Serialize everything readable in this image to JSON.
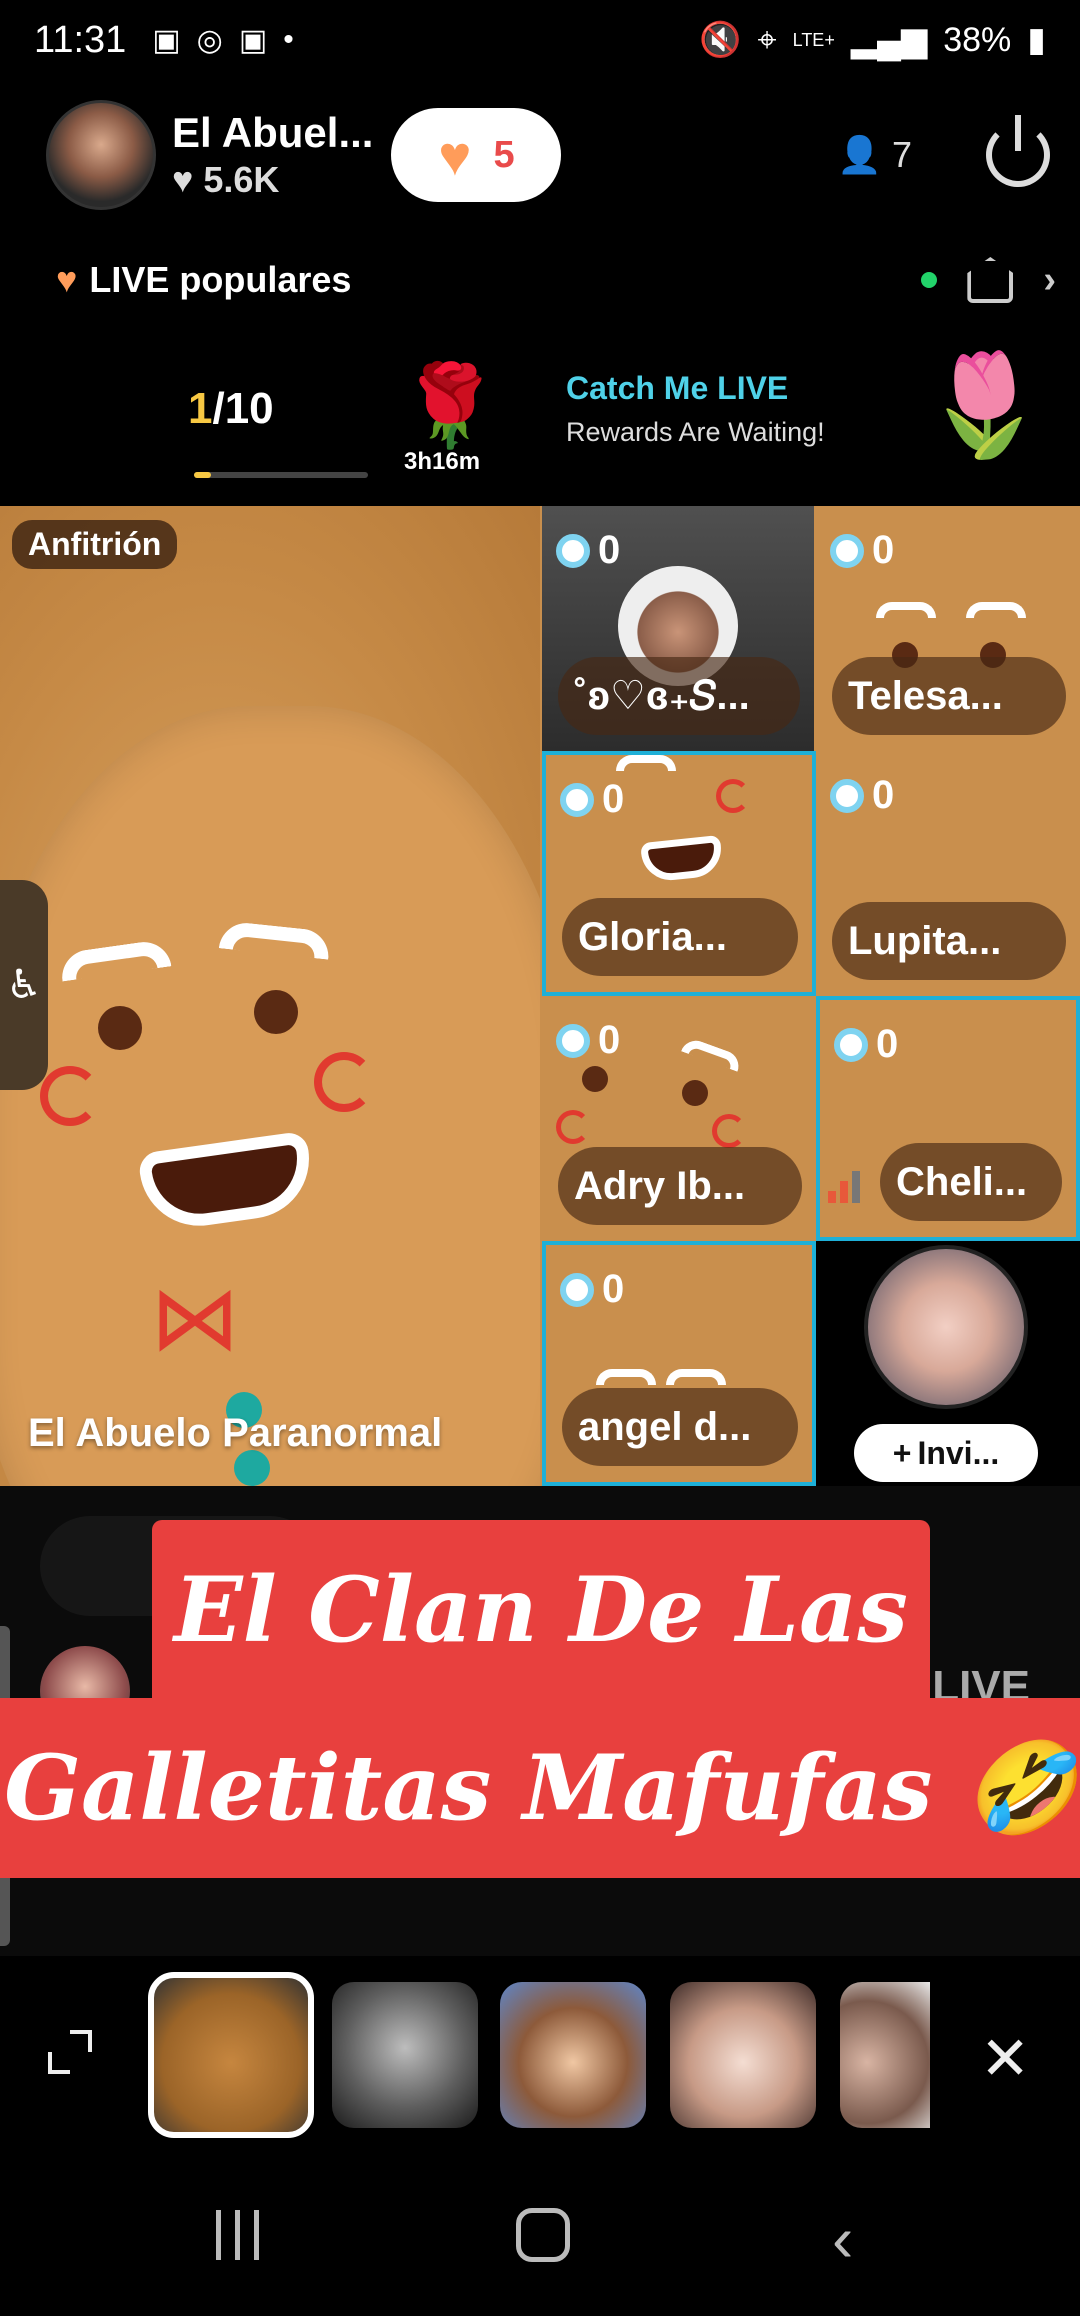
{
  "status_bar": {
    "time": "11:31",
    "left_icons": [
      "screenshot-icon",
      "whatsapp-icon",
      "screen-record-icon",
      "dot-icon"
    ],
    "network": "LTE+",
    "battery": "38%"
  },
  "header": {
    "host_name": "El Abuel...",
    "host_likes": "5.6K",
    "gift_count": "5",
    "viewers": "7"
  },
  "populares": {
    "label": "LIVE populares"
  },
  "rewards": {
    "progress_current": "1",
    "progress_total": "/10",
    "progress_fraction": 0.1,
    "rose_timer": "3h16m",
    "title": "Catch Me LIVE",
    "subtitle": "Rewards Are Waiting!"
  },
  "grid": {
    "host_badge": "Anfitrión",
    "host_label": "El Abuelo Paranormal",
    "tiles": [
      {
        "score": "0",
        "name": "˚ʚ♡ɞ₊𝑆..."
      },
      {
        "score": "0",
        "name": "Telesa..."
      },
      {
        "score": "0",
        "name": "Gloria..."
      },
      {
        "score": "0",
        "name": "Lupita..."
      },
      {
        "score": "0",
        "name": "Adry Ib..."
      },
      {
        "score": "0",
        "name": "Cheli..."
      },
      {
        "score": "0",
        "name": "angel d..."
      }
    ],
    "invite_label": "Invi..."
  },
  "under": {
    "ghost_text": "LIVE"
  },
  "caption": {
    "line1": "El Clan De Las",
    "line2": "Galletitas Mafufas 🤣"
  },
  "effects": {
    "thumbnails": [
      "gingerbread-effect",
      "zombie-effect",
      "cartoon-effect",
      "beauty-effect",
      "beard-effect"
    ],
    "close": "✕"
  },
  "colors": {
    "accent_cyan": "#1eb0d8",
    "caption_red": "#e8403e",
    "progress_yellow": "#f7c843",
    "catch_title": "#4fd1e8"
  }
}
